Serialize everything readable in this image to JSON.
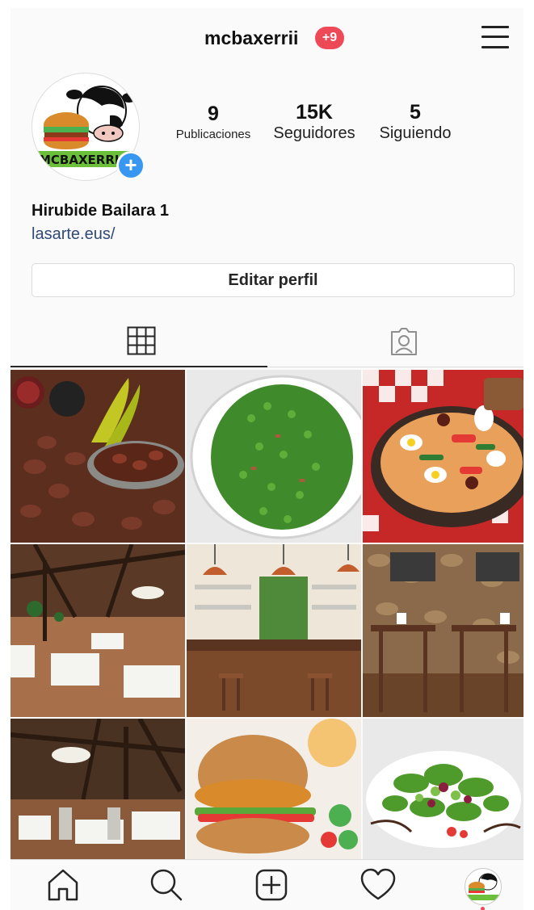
{
  "header": {
    "username": "mcbaxerrii",
    "notification_badge": "+9",
    "menu_icon": "hamburger-menu-icon",
    "badge_color": "#ed4956"
  },
  "profile": {
    "avatar_logo_text": "MCBAXERRI",
    "add_story_icon": "plus-icon",
    "stats": {
      "posts": {
        "value": "9",
        "label": "Publicaciones"
      },
      "followers": {
        "value": "15K",
        "label": "Seguidores"
      },
      "following": {
        "value": "5",
        "label": "Siguiendo"
      }
    },
    "name": "Hirubide Bailara 1",
    "website": "lasarte.eus/",
    "edit_button": "Editar perfil",
    "link_color": "#2e4a77",
    "accent_color": "#3897f0"
  },
  "tabs": [
    {
      "icon": "grid-icon",
      "active": true
    },
    {
      "icon": "tagged-person-icon",
      "active": false
    }
  ],
  "posts": [
    {
      "subject": "beans-with-sausage-and-peppers"
    },
    {
      "subject": "green-peas-dish"
    },
    {
      "subject": "egg-and-pepper-casserole"
    },
    {
      "subject": "restaurant-dining-hall"
    },
    {
      "subject": "bar-counter-with-lamps"
    },
    {
      "subject": "stone-wall-dining-tables"
    },
    {
      "subject": "timber-roof-dining-hall"
    },
    {
      "subject": "veggie-burger"
    },
    {
      "subject": "green-salad-plate"
    }
  ],
  "bottom_nav": [
    {
      "icon": "home-icon"
    },
    {
      "icon": "search-icon"
    },
    {
      "icon": "add-post-icon"
    },
    {
      "icon": "heart-icon"
    },
    {
      "icon": "profile-avatar-icon"
    }
  ]
}
